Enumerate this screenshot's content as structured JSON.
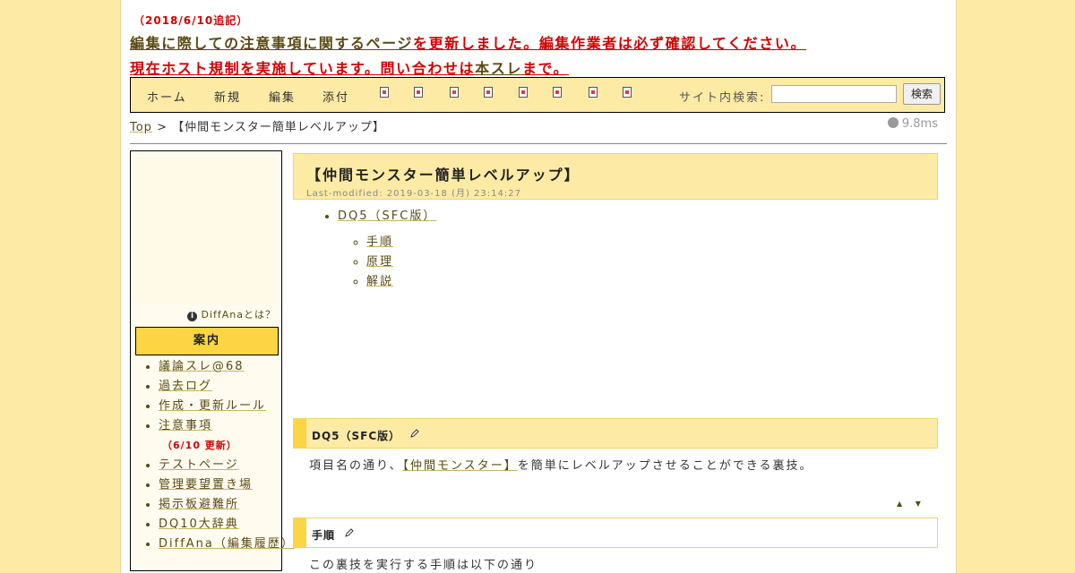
{
  "notice": {
    "date": "（2018/6/10追記）",
    "line1_link": "編集に際しての注意事項に関するページ",
    "line1_rest": "を更新しました。編集作業者は必ず確認してください。",
    "line2_start": "現在ホスト規制を実施しています。問い合わせは",
    "line2_link": "本スレ",
    "line2_end": "まで。"
  },
  "nav": {
    "links": [
      "ホーム",
      "新規",
      "編集",
      "添付"
    ],
    "tool_icons": [
      "copy-icon",
      "rename-icon",
      "diff-icon",
      "backup-icon",
      "freeze-icon",
      "list-icon",
      "recent-icon",
      "help-icon"
    ],
    "search_label": "サイト内検索:",
    "search_value": "",
    "search_button": "検索"
  },
  "breadcrumb": {
    "top": "Top",
    "sep": ">",
    "current": "【仲間モンスター簡単レベルアップ】"
  },
  "timer": "9.8ms",
  "sidebar": {
    "diffana_link": "DiffAnaとは？",
    "heading": "案内",
    "items": [
      {
        "label": "議論スレ@68"
      },
      {
        "label": "過去ログ"
      },
      {
        "label": "作成・更新ルール"
      },
      {
        "label": "注意事項"
      },
      {
        "note": "（6/10 更新）"
      },
      {
        "label": "テストページ"
      },
      {
        "label": "管理要望置き場"
      },
      {
        "label": "掲示板避難所"
      },
      {
        "label": "DQ10大辞典"
      },
      {
        "label": "DiffAna（編集履歴）"
      }
    ]
  },
  "main": {
    "title": "【仲間モンスター簡単レベルアップ】",
    "last_modified": "Last-modified: 2019-03-18 (月) 23:14:27",
    "toc": {
      "top": "DQ5（SFC版）",
      "children": [
        "手順",
        "原理",
        "解説"
      ]
    },
    "sections": [
      {
        "heading": "DQ5（SFC版）",
        "text_before": "項目名の通り、",
        "link": "【仲間モンスター】",
        "text_after": "を簡単にレベルアップさせることができる裏技。"
      },
      {
        "heading": "手順",
        "text": "この裏技を実行する手順は以下の通り"
      }
    ],
    "arrows": "▲ ▼"
  },
  "colors": {
    "page_bg": "#fdeba5",
    "accent": "#fdd443",
    "notice_red": "#d40000",
    "link": "#5a4a14"
  }
}
